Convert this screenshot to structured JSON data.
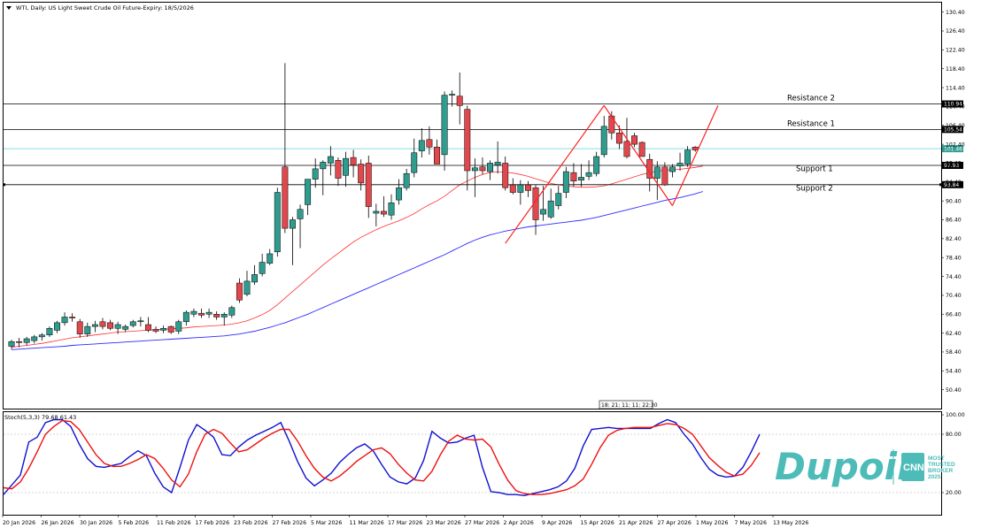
{
  "chart_title": "WTI, Daily:  US Light Sweet Crude Oil Future-Expiry: 18/5/2026",
  "chart_data": {
    "type": "candlestick",
    "price_axis": {
      "ylim": [
        46.4,
        132.4
      ],
      "ticks": [
        "130.40",
        "126.40",
        "122.40",
        "118.40",
        "114.40",
        "110.40",
        "106.40",
        "102.40",
        "98.40",
        "94.40",
        "90.40",
        "86.40",
        "82.40",
        "78.40",
        "74.40",
        "70.40",
        "66.40",
        "62.40",
        "58.40",
        "54.40",
        "50.40"
      ]
    },
    "date_labels": [
      "20 Jan 2026",
      "26 Jan 2026",
      "30 Jan 2026",
      "5 Feb 2026",
      "11 Feb 2026",
      "17 Feb 2026",
      "23 Feb 2026",
      "27 Feb 2026",
      "5 Mar 2026",
      "11 Mar 2026",
      "17 Mar 2026",
      "23 Mar 2026",
      "27 Mar 2026",
      "2 Apr 2026",
      "9 Apr 2026",
      "15 Apr 2026",
      "21 Apr 2026",
      "27 Apr 2026",
      "1 May 2026",
      "7 May 2026",
      "13 May 2026"
    ],
    "candles": [
      {
        "o": 59.6,
        "h": 61.0,
        "l": 59.0,
        "c": 60.6
      },
      {
        "o": 60.6,
        "h": 61.4,
        "l": 59.4,
        "c": 60.4
      },
      {
        "o": 60.4,
        "h": 61.6,
        "l": 59.8,
        "c": 61.2
      },
      {
        "o": 60.8,
        "h": 62.0,
        "l": 60.2,
        "c": 61.6
      },
      {
        "o": 61.6,
        "h": 62.4,
        "l": 60.8,
        "c": 62.0
      },
      {
        "o": 62.0,
        "h": 63.8,
        "l": 61.6,
        "c": 63.4
      },
      {
        "o": 63.0,
        "h": 65.0,
        "l": 62.4,
        "c": 64.6
      },
      {
        "o": 64.6,
        "h": 66.8,
        "l": 64.0,
        "c": 65.8
      },
      {
        "o": 65.8,
        "h": 66.6,
        "l": 64.8,
        "c": 65.6
      },
      {
        "o": 64.8,
        "h": 65.4,
        "l": 61.4,
        "c": 62.2
      },
      {
        "o": 62.2,
        "h": 64.6,
        "l": 61.6,
        "c": 63.8
      },
      {
        "o": 63.8,
        "h": 65.0,
        "l": 62.6,
        "c": 64.2
      },
      {
        "o": 64.8,
        "h": 65.6,
        "l": 63.2,
        "c": 63.8
      },
      {
        "o": 64.6,
        "h": 65.2,
        "l": 63.0,
        "c": 63.4
      },
      {
        "o": 63.4,
        "h": 64.8,
        "l": 62.2,
        "c": 64.2
      },
      {
        "o": 63.2,
        "h": 64.2,
        "l": 62.6,
        "c": 63.8
      },
      {
        "o": 64.0,
        "h": 65.2,
        "l": 63.6,
        "c": 64.8
      },
      {
        "o": 64.8,
        "h": 65.8,
        "l": 63.8,
        "c": 65.0
      },
      {
        "o": 64.2,
        "h": 65.8,
        "l": 62.6,
        "c": 63.0
      },
      {
        "o": 63.2,
        "h": 63.8,
        "l": 62.4,
        "c": 62.8
      },
      {
        "o": 63.0,
        "h": 64.0,
        "l": 62.4,
        "c": 63.4
      },
      {
        "o": 63.8,
        "h": 64.0,
        "l": 62.2,
        "c": 62.6
      },
      {
        "o": 62.8,
        "h": 65.2,
        "l": 62.2,
        "c": 64.8
      },
      {
        "o": 64.8,
        "h": 67.2,
        "l": 64.0,
        "c": 66.8
      },
      {
        "o": 66.4,
        "h": 67.6,
        "l": 65.8,
        "c": 67.0
      },
      {
        "o": 66.6,
        "h": 67.6,
        "l": 65.6,
        "c": 66.2
      },
      {
        "o": 66.4,
        "h": 67.6,
        "l": 65.6,
        "c": 66.8
      },
      {
        "o": 66.4,
        "h": 67.0,
        "l": 65.2,
        "c": 65.8
      },
      {
        "o": 65.8,
        "h": 66.8,
        "l": 64.0,
        "c": 66.4
      },
      {
        "o": 66.2,
        "h": 68.2,
        "l": 65.6,
        "c": 67.8
      },
      {
        "o": 73.0,
        "h": 74.0,
        "l": 68.8,
        "c": 69.4
      },
      {
        "o": 70.6,
        "h": 75.6,
        "l": 70.2,
        "c": 73.4
      },
      {
        "o": 73.2,
        "h": 76.8,
        "l": 72.6,
        "c": 74.8
      },
      {
        "o": 75.0,
        "h": 79.2,
        "l": 74.4,
        "c": 77.4
      },
      {
        "o": 77.2,
        "h": 80.2,
        "l": 76.8,
        "c": 79.2
      },
      {
        "o": 79.6,
        "h": 93.2,
        "l": 78.6,
        "c": 92.2
      },
      {
        "o": 97.6,
        "h": 119.6,
        "l": 83.6,
        "c": 84.6
      },
      {
        "o": 84.6,
        "h": 87.0,
        "l": 76.8,
        "c": 86.4
      },
      {
        "o": 86.6,
        "h": 89.6,
        "l": 80.4,
        "c": 88.6
      },
      {
        "o": 89.6,
        "h": 94.2,
        "l": 87.4,
        "c": 95.0
      },
      {
        "o": 95.0,
        "h": 99.4,
        "l": 93.2,
        "c": 97.2
      },
      {
        "o": 97.2,
        "h": 99.0,
        "l": 91.6,
        "c": 98.6
      },
      {
        "o": 98.4,
        "h": 102.0,
        "l": 95.8,
        "c": 99.8
      },
      {
        "o": 99.0,
        "h": 99.6,
        "l": 93.6,
        "c": 95.2
      },
      {
        "o": 95.8,
        "h": 100.8,
        "l": 93.4,
        "c": 99.4
      },
      {
        "o": 99.6,
        "h": 101.2,
        "l": 95.4,
        "c": 98.0
      },
      {
        "o": 98.2,
        "h": 99.2,
        "l": 92.6,
        "c": 94.2
      },
      {
        "o": 98.4,
        "h": 100.0,
        "l": 86.8,
        "c": 89.2
      },
      {
        "o": 87.8,
        "h": 89.8,
        "l": 85.0,
        "c": 88.2
      },
      {
        "o": 88.2,
        "h": 91.4,
        "l": 87.0,
        "c": 87.6
      },
      {
        "o": 87.4,
        "h": 91.8,
        "l": 86.4,
        "c": 90.0
      },
      {
        "o": 90.6,
        "h": 95.0,
        "l": 89.6,
        "c": 93.2
      },
      {
        "o": 93.2,
        "h": 97.2,
        "l": 92.6,
        "c": 96.2
      },
      {
        "o": 96.4,
        "h": 103.6,
        "l": 95.4,
        "c": 100.6
      },
      {
        "o": 101.0,
        "h": 105.8,
        "l": 99.6,
        "c": 103.2
      },
      {
        "o": 103.4,
        "h": 106.2,
        "l": 100.2,
        "c": 101.8
      },
      {
        "o": 101.8,
        "h": 103.4,
        "l": 98.6,
        "c": 98.2
      },
      {
        "o": 100.2,
        "h": 113.6,
        "l": 96.8,
        "c": 112.8
      },
      {
        "o": 112.8,
        "h": 113.8,
        "l": 110.4,
        "c": 113.0
      },
      {
        "o": 112.6,
        "h": 117.6,
        "l": 106.6,
        "c": 110.6
      },
      {
        "o": 109.8,
        "h": 110.6,
        "l": 92.6,
        "c": 96.8
      },
      {
        "o": 96.8,
        "h": 99.4,
        "l": 91.2,
        "c": 97.4
      },
      {
        "o": 97.6,
        "h": 99.6,
        "l": 96.0,
        "c": 96.8
      },
      {
        "o": 96.6,
        "h": 99.0,
        "l": 94.8,
        "c": 98.4
      },
      {
        "o": 98.0,
        "h": 103.0,
        "l": 96.2,
        "c": 98.6
      },
      {
        "o": 98.4,
        "h": 99.8,
        "l": 92.6,
        "c": 93.2
      },
      {
        "o": 93.8,
        "h": 95.2,
        "l": 91.8,
        "c": 92.2
      },
      {
        "o": 92.2,
        "h": 94.8,
        "l": 89.6,
        "c": 93.8
      },
      {
        "o": 93.8,
        "h": 94.6,
        "l": 91.2,
        "c": 92.6
      },
      {
        "o": 93.2,
        "h": 93.8,
        "l": 83.2,
        "c": 86.4
      },
      {
        "o": 87.6,
        "h": 93.6,
        "l": 86.2,
        "c": 88.6
      },
      {
        "o": 87.0,
        "h": 93.0,
        "l": 86.6,
        "c": 90.4
      },
      {
        "o": 89.4,
        "h": 93.6,
        "l": 88.6,
        "c": 92.0
      },
      {
        "o": 92.2,
        "h": 97.6,
        "l": 91.0,
        "c": 96.6
      },
      {
        "o": 96.4,
        "h": 98.4,
        "l": 93.4,
        "c": 94.6
      },
      {
        "o": 94.8,
        "h": 98.2,
        "l": 93.4,
        "c": 95.4
      },
      {
        "o": 95.6,
        "h": 99.0,
        "l": 94.8,
        "c": 96.4
      },
      {
        "o": 96.2,
        "h": 100.8,
        "l": 95.6,
        "c": 99.8
      },
      {
        "o": 100.2,
        "h": 108.4,
        "l": 99.6,
        "c": 106.2
      },
      {
        "o": 108.4,
        "h": 109.4,
        "l": 103.4,
        "c": 104.8
      },
      {
        "o": 104.8,
        "h": 106.4,
        "l": 101.4,
        "c": 102.6
      },
      {
        "o": 103.0,
        "h": 108.0,
        "l": 99.4,
        "c": 99.8
      },
      {
        "o": 104.2,
        "h": 104.8,
        "l": 101.8,
        "c": 102.4
      },
      {
        "o": 102.8,
        "h": 103.0,
        "l": 99.8,
        "c": 99.8
      },
      {
        "o": 99.2,
        "h": 100.4,
        "l": 92.4,
        "c": 95.2
      },
      {
        "o": 95.2,
        "h": 98.8,
        "l": 90.6,
        "c": 97.6
      },
      {
        "o": 97.6,
        "h": 98.6,
        "l": 93.6,
        "c": 93.8
      },
      {
        "o": 96.6,
        "h": 98.2,
        "l": 95.4,
        "c": 97.6
      },
      {
        "o": 97.8,
        "h": 100.6,
        "l": 96.8,
        "c": 98.4
      },
      {
        "o": 98.2,
        "h": 102.0,
        "l": 97.6,
        "c": 101.2
      },
      {
        "o": 101.8,
        "h": 102.0,
        "l": 100.8,
        "c": 101.2
      }
    ],
    "ma_fast": [
      59.4,
      59.6,
      59.8,
      60.0,
      60.2,
      60.5,
      60.8,
      61.1,
      61.4,
      61.6,
      61.8,
      62.0,
      62.2,
      62.4,
      62.6,
      62.7,
      62.8,
      62.9,
      63.0,
      63.1,
      63.2,
      63.3,
      63.4,
      63.5,
      63.7,
      63.8,
      63.9,
      64.0,
      64.1,
      64.3,
      64.6,
      65.0,
      65.6,
      66.3,
      67.2,
      68.4,
      69.8,
      71.2,
      72.6,
      74.0,
      75.4,
      76.8,
      78.1,
      79.3,
      80.5,
      81.7,
      82.7,
      83.5,
      84.3,
      85.0,
      85.6,
      86.2,
      86.9,
      87.7,
      88.7,
      89.6,
      90.4,
      91.4,
      92.6,
      93.8,
      94.6,
      95.4,
      96.0,
      96.4,
      96.6,
      96.5,
      96.3,
      96.0,
      95.6,
      95.1,
      94.6,
      94.1,
      93.8,
      93.6,
      93.4,
      93.3,
      93.3,
      93.4,
      93.6,
      94.0,
      94.5,
      95.0,
      95.5,
      96.0,
      96.4,
      96.7,
      96.9,
      97.0,
      97.1,
      97.3,
      97.5,
      97.8
    ],
    "ma_slow": [
      58.9,
      59.0,
      59.1,
      59.2,
      59.3,
      59.4,
      59.5,
      59.6,
      59.8,
      59.9,
      60.0,
      60.1,
      60.2,
      60.3,
      60.4,
      60.5,
      60.6,
      60.7,
      60.8,
      60.9,
      61.0,
      61.1,
      61.2,
      61.3,
      61.4,
      61.5,
      61.6,
      61.7,
      61.8,
      62.0,
      62.2,
      62.5,
      62.8,
      63.2,
      63.6,
      64.1,
      64.6,
      65.2,
      65.8,
      66.4,
      67.1,
      67.8,
      68.5,
      69.2,
      69.9,
      70.6,
      71.3,
      72.0,
      72.7,
      73.4,
      74.1,
      74.8,
      75.5,
      76.2,
      76.9,
      77.6,
      78.3,
      79.0,
      79.8,
      80.6,
      81.4,
      82.1,
      82.7,
      83.2,
      83.6,
      84.0,
      84.3,
      84.6,
      84.9,
      85.1,
      85.3,
      85.5,
      85.7,
      85.9,
      86.1,
      86.3,
      86.6,
      86.9,
      87.3,
      87.7,
      88.1,
      88.5,
      88.9,
      89.3,
      89.7,
      90.1,
      90.5,
      90.8,
      91.1,
      91.5,
      91.9,
      92.4
    ],
    "horizontal_lines": [
      {
        "label": "Resistance 2",
        "value": 110.94,
        "tag": "110.94"
      },
      {
        "label": "Resistance 1",
        "value": 105.54,
        "tag": "105.54"
      },
      {
        "label": "Support 1",
        "value": 97.93,
        "tag": "97.93"
      },
      {
        "label": "Support 2",
        "value": 93.84,
        "tag": "93.84"
      }
    ],
    "current_price": {
      "value": 101.46,
      "tag": "101.46"
    },
    "trend_lines": [
      {
        "from": [
          65,
          81.4
        ],
        "to": [
          78,
          110.6
        ]
      },
      {
        "from": [
          78,
          110.6
        ],
        "to": [
          87,
          89.4
        ]
      },
      {
        "from": [
          87,
          89.4
        ],
        "to": [
          93,
          110.6
        ]
      }
    ],
    "crosshair_tag": "18: 21: 11: 11: 22:30",
    "stochastic": {
      "title": "Stoch(5,3,3) 79.68 61.43",
      "ylim": [
        0,
        100
      ],
      "ticks": [
        "100.00",
        "80.00",
        "20.00"
      ],
      "levels": [
        80,
        20
      ],
      "k": [
        18,
        28,
        38,
        72,
        77,
        92,
        95,
        95,
        88,
        70,
        55,
        47,
        46,
        48,
        50,
        57,
        63,
        58,
        40,
        26,
        20,
        46,
        74,
        90,
        84,
        77,
        59,
        58,
        67,
        74,
        79,
        83,
        87,
        92,
        73,
        52,
        35,
        27,
        33,
        40,
        51,
        59,
        66,
        70,
        63,
        49,
        36,
        31,
        29,
        35,
        53,
        83,
        76,
        71,
        72,
        76,
        79,
        46,
        21,
        20,
        18,
        18,
        17,
        19,
        21,
        23,
        26,
        32,
        45,
        68,
        85,
        86,
        87,
        86,
        86,
        86,
        86,
        86,
        91,
        95,
        92,
        80,
        70,
        56,
        44,
        38,
        36,
        37,
        46,
        62,
        80
      ],
      "d": [
        25,
        24,
        31,
        45,
        62,
        80,
        88,
        94,
        93,
        85,
        72,
        59,
        50,
        47,
        47,
        50,
        54,
        59,
        55,
        45,
        33,
        26,
        39,
        62,
        80,
        85,
        81,
        71,
        62,
        64,
        70,
        76,
        81,
        85,
        85,
        73,
        58,
        45,
        36,
        32,
        37,
        44,
        52,
        58,
        64,
        66,
        60,
        49,
        40,
        33,
        32,
        42,
        59,
        73,
        79,
        75,
        74,
        75,
        67,
        49,
        33,
        22,
        19,
        18,
        18,
        19,
        21,
        23,
        27,
        34,
        49,
        66,
        79,
        84,
        86,
        87,
        87,
        87,
        89,
        91,
        90,
        86,
        80,
        68,
        56,
        48,
        41,
        37,
        39,
        48,
        61
      ]
    },
    "brand": {
      "name": "Dupoin",
      "badge": "CNN",
      "tagline": [
        "MOST",
        "TRUSTED",
        "BROKER",
        "2025"
      ],
      "color": "#4dbcb8"
    }
  }
}
